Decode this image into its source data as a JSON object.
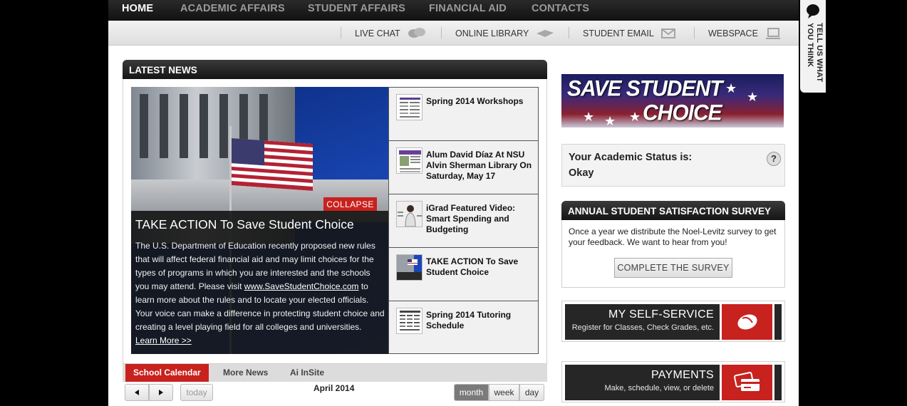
{
  "nav": {
    "items": [
      {
        "label": "HOME",
        "active": true
      },
      {
        "label": "ACADEMIC AFFAIRS",
        "active": false
      },
      {
        "label": "STUDENT AFFAIRS",
        "active": false
      },
      {
        "label": "FINANCIAL AID",
        "active": false
      },
      {
        "label": "CONTACTS",
        "active": false
      }
    ]
  },
  "utility": {
    "live_chat": {
      "label": "LIVE CHAT",
      "icon": "chat-bubbles-icon"
    },
    "online_library": {
      "label": "ONLINE LIBRARY",
      "icon": "book-icon"
    },
    "student_email": {
      "label": "STUDENT EMAIL",
      "icon": "envelope-icon"
    },
    "webspace": {
      "label": "WEBSPACE",
      "icon": "laptop-icon"
    }
  },
  "feedback_tab": {
    "label": "TELL US WHAT YOU THINK",
    "icon": "speech-bubble-icon"
  },
  "latest_news": {
    "title": "LATEST NEWS",
    "featured": {
      "collapse_label": "COLLAPSE",
      "title": "TAKE ACTION To Save Student Choice",
      "body_before_link": "The U.S. Department of Education recently proposed new rules that will affect federal financial aid and may limit choices for the types of programs in which you are interested and the schools you may attend. Please visit ",
      "link_text": "www.SaveStudentChoice.com",
      "body_after_link": " to learn more about the rules and to locate your elected officials. Your voice can make a difference in protecting student choice and creating a level playing field for all colleges and universities.",
      "more_label": "Learn More >>"
    },
    "items": [
      {
        "title": "Spring 2014 Workshops"
      },
      {
        "title": "Alum David Díaz At NSU Alvin Sherman Library On Saturday, May 17"
      },
      {
        "title": "iGrad Featured Video: Smart Spending and Budgeting"
      },
      {
        "title": "TAKE ACTION To Save Student Choice"
      },
      {
        "title": "Spring 2014 Tutoring Schedule"
      }
    ]
  },
  "calendar": {
    "tabs": [
      "School Calendar",
      "More News",
      "Ai InSite"
    ],
    "active_tab": "School Calendar",
    "today_label": "today",
    "month_label": "April 2014",
    "views": [
      "month",
      "week",
      "day"
    ],
    "active_view": "month"
  },
  "banner": {
    "line1": "SAVE STUDENT",
    "line2": "CHOICE"
  },
  "academic_status": {
    "label": "Your Academic Status is:",
    "value": "Okay",
    "help": "?"
  },
  "survey": {
    "title": "ANNUAL STUDENT SATISFACTION SURVEY",
    "text": "Once a year we distribute the Noel-Levitz survey to get your feedback. We want to hear from you!",
    "button": "COMPLETE THE SURVEY"
  },
  "tiles": [
    {
      "title": "MY SELF-SERVICE",
      "subtitle": "Register for Classes, Check Grades, etc.",
      "icon": "mouse-icon"
    },
    {
      "title": "PAYMENTS",
      "subtitle": "Make, schedule, view, or delete",
      "icon": "credit-card-icon"
    }
  ],
  "colors": {
    "accent_red": "#c8221e",
    "nav_dark": "#1a1a1a",
    "tile_dark": "#262626"
  }
}
